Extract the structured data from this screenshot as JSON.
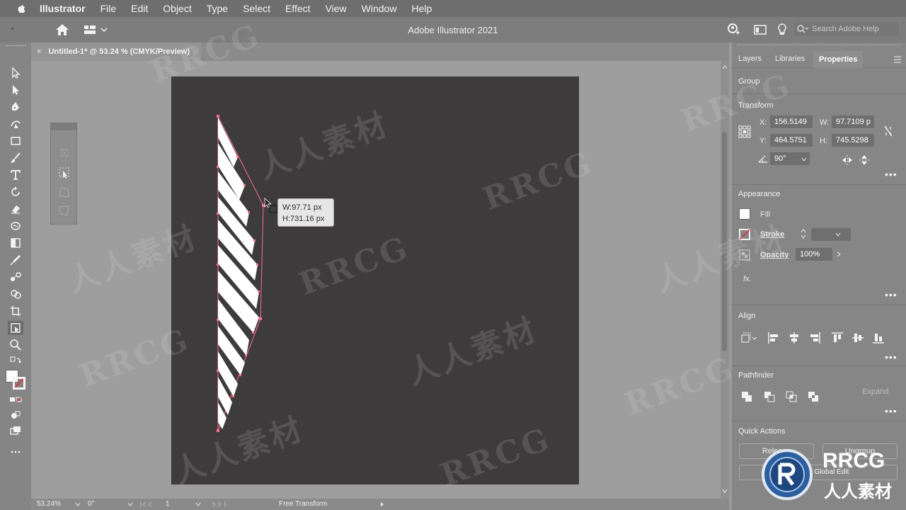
{
  "menubar": {
    "items": [
      "Illustrator",
      "File",
      "Edit",
      "Object",
      "Type",
      "Select",
      "Effect",
      "View",
      "Window",
      "Help"
    ]
  },
  "appbar": {
    "title": "Adobe Illustrator 2021",
    "search_placeholder": "Search Adobe Help"
  },
  "document": {
    "tab_title": "Untitled-1* @ 53.24 % (CMYK/Preview)",
    "close_glyph": "×"
  },
  "tooltip": {
    "width": "W:97.71 px",
    "height": "H:731.16 px"
  },
  "statusbar": {
    "zoom": "53.24%",
    "rotation": "0°",
    "artboard": "1",
    "tool": "Free Transform"
  },
  "properties": {
    "tabs": [
      "Layers",
      "Libraries",
      "Properties"
    ],
    "active_tab": "Properties",
    "selection": "Group",
    "transform": {
      "heading": "Transform",
      "x_label": "X:",
      "x": "156.5149",
      "y_label": "Y:",
      "y": "464.5751",
      "w_label": "W:",
      "w": "97.7109 p",
      "h_label": "H:",
      "h": "745.5298",
      "angle": "90°"
    },
    "appearance": {
      "heading": "Appearance",
      "fill": "Fill",
      "stroke": "Stroke",
      "opacity_label": "Opacity",
      "opacity": "100%",
      "fx": "fx."
    },
    "align": {
      "heading": "Align"
    },
    "pathfinder": {
      "heading": "Pathfinder",
      "expand": "Expand"
    },
    "quick_actions": {
      "heading": "Quick Actions",
      "release": "Release",
      "ungroup": "Ungroup",
      "edit": "Isolate / Global Edit"
    }
  },
  "watermark": {
    "latin": "RRCG",
    "cjk": "人人素材"
  },
  "colors": {
    "artboard": "#3d3b3b",
    "selection": "#ff6f8f",
    "artwork": "#ffffff"
  }
}
